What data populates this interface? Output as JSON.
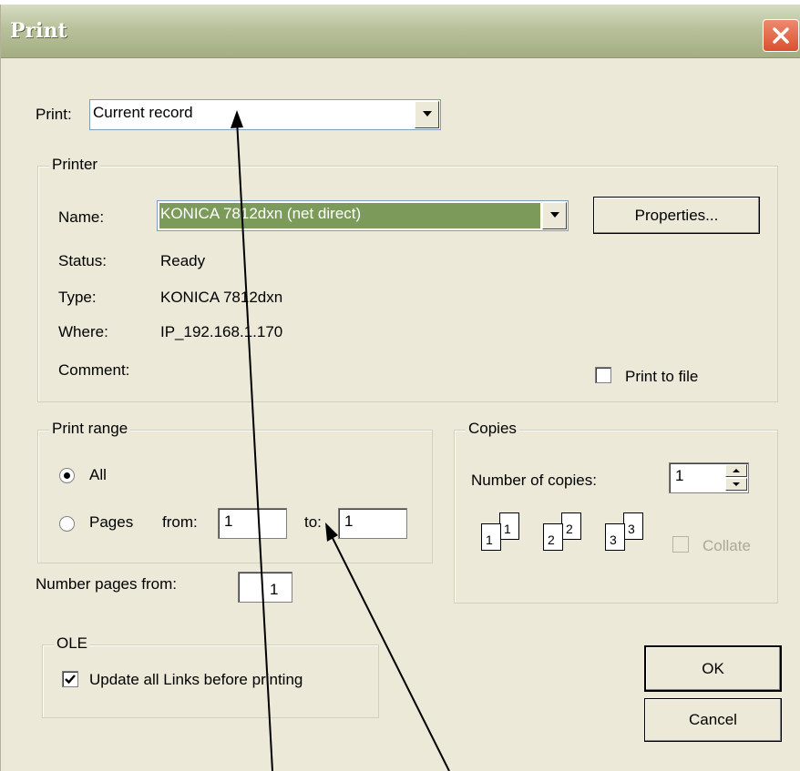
{
  "window": {
    "title": "Print"
  },
  "print_what": {
    "label": "Print:",
    "value": "Current record"
  },
  "printer": {
    "legend": "Printer",
    "name_label": "Name:",
    "name_value": "KONICA 7812dxn (net direct)",
    "properties_button": "Properties...",
    "status_label": "Status:",
    "status_value": "Ready",
    "type_label": "Type:",
    "type_value": "KONICA 7812dxn",
    "where_label": "Where:",
    "where_value": "IP_192.168.1.170",
    "comment_label": "Comment:",
    "print_to_file_label": "Print to file",
    "print_to_file_checked": false
  },
  "print_range": {
    "legend": "Print range",
    "all_label": "All",
    "pages_label": "Pages",
    "from_label": "from:",
    "from_value": "1",
    "to_label": "to:",
    "to_value": "1",
    "selected": "All"
  },
  "copies": {
    "legend": "Copies",
    "number_label": "Number of copies:",
    "number_value": "1",
    "collate_label": "Collate",
    "collate_checked": false,
    "collate_enabled": false,
    "icon_pages": [
      "1",
      "1",
      "2",
      "2",
      "3",
      "3"
    ]
  },
  "number_pages_from": {
    "label": "Number pages from:",
    "value": "1"
  },
  "ole": {
    "legend": "OLE",
    "update_links_label": "Update all Links before printing",
    "update_links_checked": true
  },
  "buttons": {
    "ok": "OK",
    "cancel": "Cancel"
  },
  "colors": {
    "selection_highlight": "#7c9a5a",
    "title_bar": "#b8c19b",
    "close_button": "#d9512f",
    "dialog_background": "#ece9d8"
  }
}
